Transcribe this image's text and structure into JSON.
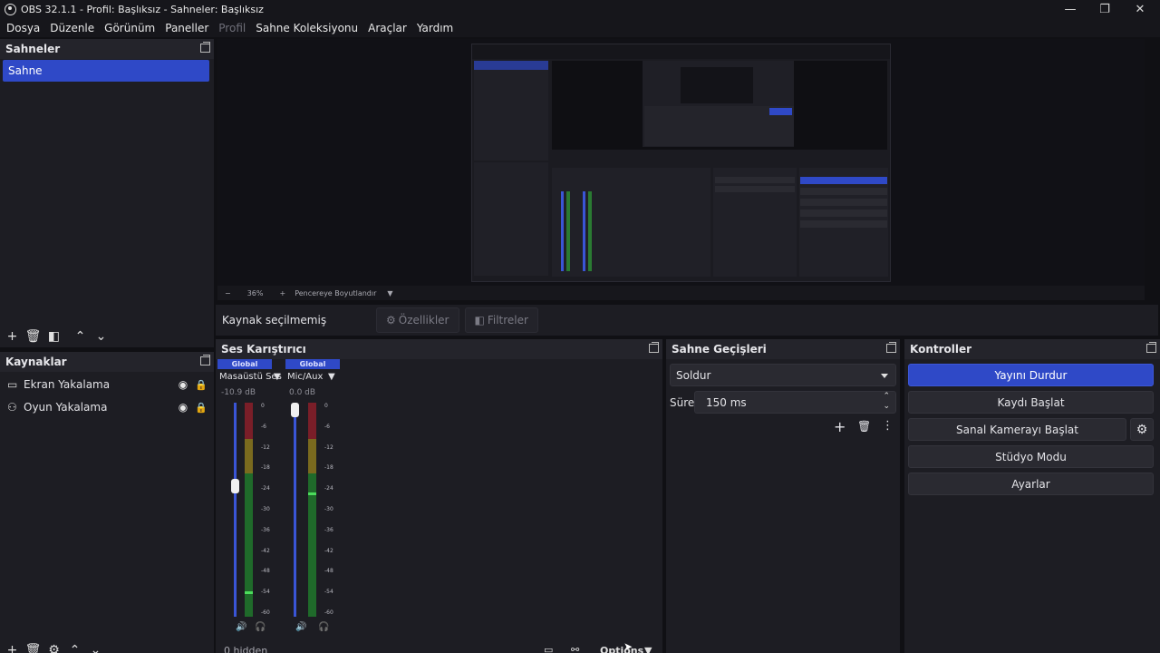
{
  "window": {
    "title": "OBS 32.1.1 - Profil: Başlıksız - Sahneler: Başlıksız",
    "minimize_icon": "—",
    "maximize_icon": "❐",
    "close_icon": "✕"
  },
  "menu": {
    "items": [
      "Dosya",
      "Düzenle",
      "Görünüm",
      "Paneller",
      "Profil",
      "Sahne Koleksiyonu",
      "Araçlar",
      "Yardım"
    ],
    "disabled_index": 4
  },
  "scenes": {
    "title": "Sahneler",
    "items": [
      "Sahne"
    ],
    "selected": 0
  },
  "sources": {
    "title": "Kaynaklar",
    "items": [
      {
        "label": "Ekran Yakalama",
        "icon": "monitor-icon"
      },
      {
        "label": "Oyun Yakalama",
        "icon": "gamepad-icon"
      }
    ]
  },
  "preview": {
    "zoom_label": "36%",
    "resize_label": "Pencereye Boyutlandır"
  },
  "context_bar": {
    "label": "Kaynak seçilmemiş",
    "properties_button": "Özellikler",
    "filters_button": "Filtreler"
  },
  "mixer": {
    "title": "Ses Karıştırıcı",
    "channels": [
      {
        "tag": "Global",
        "name": "Masaüstü Ses",
        "db": "-10.9 dB",
        "volume": 0.62,
        "level": 0.12
      },
      {
        "tag": "Global",
        "name": "Mic/Aux",
        "db": "0.0 dB",
        "volume": 1.0,
        "level": 0.58
      }
    ],
    "scale": [
      "0",
      "-6",
      "-12",
      "-18",
      "-24",
      "-30",
      "-36",
      "-42",
      "-48",
      "-54",
      "-60"
    ],
    "hidden_label": "0 hidden",
    "options_label": "Options"
  },
  "transitions": {
    "title": "Sahne Geçişleri",
    "selected": "Soldur",
    "duration_label": "Süre",
    "duration_value": "150 ms"
  },
  "controls": {
    "title": "Kontroller",
    "buttons": [
      "Yayını Durdur",
      "Kaydı Başlat",
      "Sanal Kamerayı Başlat",
      "Stüdyo Modu",
      "Ayarlar"
    ]
  },
  "colors": {
    "accent": "#2f49c7",
    "background": "#101014",
    "dock": "#1d1d23"
  }
}
